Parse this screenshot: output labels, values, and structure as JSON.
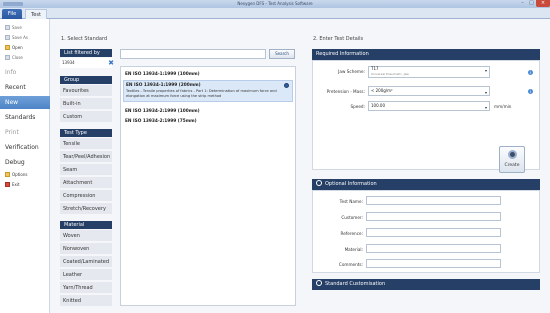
{
  "window": {
    "title": "Nexygen DFS - Test Analysis Software"
  },
  "ribbon": {
    "tabs": [
      {
        "label": "File"
      },
      {
        "label": "Test"
      }
    ]
  },
  "backstage": {
    "commands": [
      {
        "label": "Save",
        "icon": "save-icon"
      },
      {
        "label": "Save As",
        "icon": "save-as-icon"
      },
      {
        "label": "Open",
        "icon": "open-folder-icon"
      },
      {
        "label": "Close",
        "icon": "close-document-icon"
      }
    ],
    "tabs": [
      {
        "label": "Info",
        "state": "disabled"
      },
      {
        "label": "Recent",
        "state": "normal"
      },
      {
        "label": "New",
        "state": "selected"
      },
      {
        "label": "Standards",
        "state": "normal"
      },
      {
        "label": "Print",
        "state": "disabled"
      },
      {
        "label": "Verification",
        "state": "normal"
      },
      {
        "label": "Debug",
        "state": "normal"
      }
    ],
    "bottom_commands": [
      {
        "label": "Options",
        "icon": "options-icon"
      },
      {
        "label": "Exit",
        "icon": "exit-icon"
      }
    ],
    "selected_color": "#4d84c7"
  },
  "select_standard": {
    "heading": "1. Select Standard",
    "filter_header": "List filtered by",
    "filter_value": "13934",
    "group_header": "Group",
    "groups": [
      "Favourites",
      "Built-in",
      "Custom"
    ],
    "test_type_header": "Test Type",
    "test_types": [
      "Tensile",
      "Tear/Peel/Adhesion",
      "Seam",
      "Attachment",
      "Compression",
      "Stretch/Recovery"
    ],
    "material_header": "Material",
    "materials": [
      "Woven",
      "Nonwoven",
      "Coated/Laminated",
      "Leather",
      "Yarn/Thread",
      "Knitted"
    ],
    "search_placeholder": "",
    "search_button": "Search",
    "results": [
      {
        "title": "EN ISO 13934-1:1999 (100mm)",
        "desc": "",
        "selected": false
      },
      {
        "title": "EN ISO 13934-1:1999 (200mm)",
        "desc": "Textiles - Tensile properties of fabrics - Part 1: Determination of maximum force and elongation at maximum force using the strip method",
        "selected": true
      },
      {
        "title": "EN ISO 13934-2:1999 (100mm)",
        "desc": "",
        "selected": false
      },
      {
        "title": "EN ISO 13934-2:1999 (75mm)",
        "desc": "",
        "selected": false
      }
    ]
  },
  "test_details": {
    "heading": "2. Enter Test Details",
    "required_header": "Required Information",
    "jaw_scheme_label": "Jaw Scheme:",
    "jaw_scheme_value": "T17",
    "jaw_scheme_sub": "Universal Pneumatic, Jaw",
    "pretension_label": "Pretension - Mass:",
    "pretension_value": "< 200g/m²",
    "speed_label": "Speed:",
    "speed_value": "100.00",
    "speed_units": "mm/min",
    "create_label": "Create",
    "optional_header": "Optional Information",
    "optional_fields": [
      {
        "label": "Test Name:",
        "value": ""
      },
      {
        "label": "Customer:",
        "value": ""
      },
      {
        "label": "Reference:",
        "value": ""
      },
      {
        "label": "Material:",
        "value": ""
      },
      {
        "label": "Comments:",
        "value": ""
      }
    ],
    "customisation_header": "Standard Customisation"
  },
  "colors": {
    "header_navy": "#263f66",
    "accent_blue": "#4a8ad6"
  }
}
